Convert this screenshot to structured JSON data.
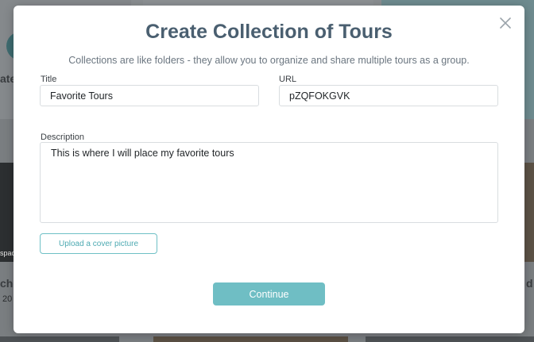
{
  "background": {
    "fragments": {
      "left_title": "ate",
      "left_card_title": "che",
      "left_card_date": "20",
      "left_thumb_caption": "spac",
      "right_card_title": "d"
    }
  },
  "modal": {
    "title": "Create Collection of Tours",
    "subtitle": "Collections are like folders - they allow you to organize and share multiple tours as a group.",
    "close_icon": "close-icon",
    "fields": {
      "title": {
        "label": "Title",
        "value": "Favorite Tours"
      },
      "url": {
        "label": "URL",
        "value": "pZQFOKGVK"
      },
      "description": {
        "label": "Description",
        "value": "This is where I will place my favorite tours"
      }
    },
    "upload_label": "Upload a cover picture",
    "continue_label": "Continue"
  },
  "colors": {
    "accent": "#6fbec4",
    "title": "#4a5f70",
    "border": "#d9dde0"
  }
}
